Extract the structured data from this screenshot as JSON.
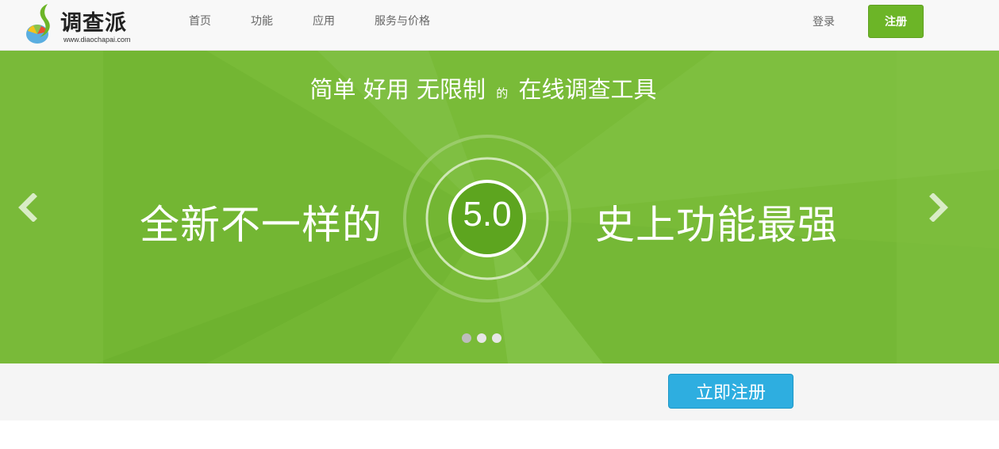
{
  "header": {
    "logo": {
      "name": "调查派",
      "url": "www.diaochapai.com"
    },
    "nav": [
      {
        "label": "首页"
      },
      {
        "label": "功能"
      },
      {
        "label": "应用"
      },
      {
        "label": "服务与价格"
      }
    ],
    "login_label": "登录",
    "register_label": "注册"
  },
  "banner": {
    "tagline": {
      "part1": "简单 好用 无限制",
      "connector": "的",
      "part2": "在线调查工具"
    },
    "slogan_left": "全新不一样的",
    "version": "5.0",
    "slogan_right": "史上功能最强",
    "slides_total": 3,
    "active_slide": 1
  },
  "cta": {
    "label": "立即注册"
  },
  "colors": {
    "banner_green": "#79bb38",
    "register_green": "#6cb527",
    "cta_blue": "#2eaee0",
    "header_bg": "#f8f8f8"
  },
  "icons": {
    "prev": "chevron-left-icon",
    "next": "chevron-right-icon"
  }
}
